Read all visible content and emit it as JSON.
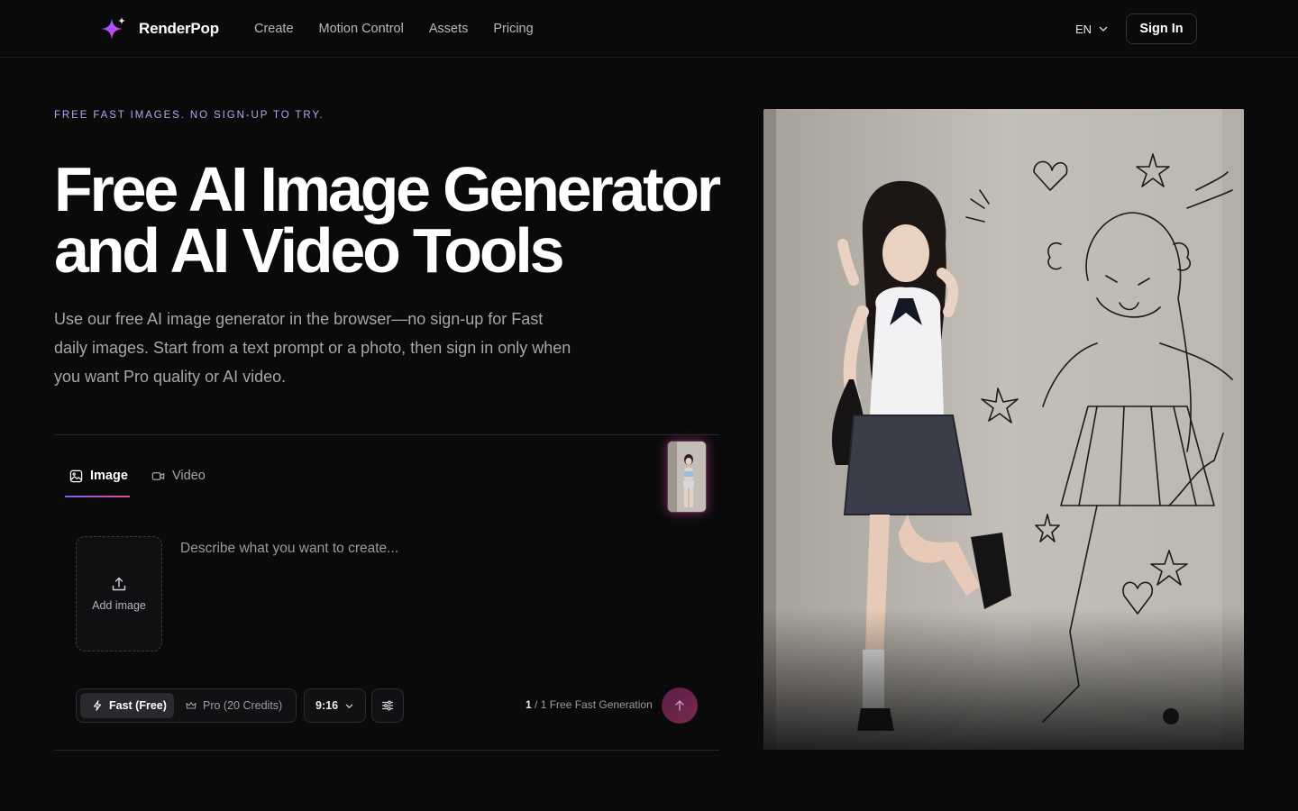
{
  "header": {
    "brand": "RenderPop",
    "nav": [
      "Create",
      "Motion Control",
      "Assets",
      "Pricing"
    ],
    "language": "EN",
    "sign_in_label": "Sign In"
  },
  "hero": {
    "eyebrow": "FREE FAST IMAGES. NO SIGN-UP TO TRY.",
    "title_line1": "Free AI Image Generator",
    "title_line2": "and AI Video Tools",
    "description": "Use our free AI image generator in the browser—no sign-up for Fast daily images. Start from a text prompt or a photo, then sign in only when you want Pro quality or AI video."
  },
  "composer": {
    "tabs": [
      {
        "label": "Image",
        "icon": "image-icon",
        "active": true
      },
      {
        "label": "Video",
        "icon": "video-icon",
        "active": false
      }
    ],
    "add_image_label": "Add image",
    "prompt_placeholder": "Describe what you want to create...",
    "modes": [
      {
        "label": "Fast (Free)",
        "icon": "bolt-icon",
        "selected": true
      },
      {
        "label": "Pro (20 Credits)",
        "icon": "crown-icon",
        "selected": false
      }
    ],
    "aspect_ratio": "9:16",
    "quota_used": "1",
    "quota_rest": "/ 1 Free Fast Generation"
  },
  "colors": {
    "background": "#0a0a0b",
    "eyebrow": "#b9a6f6",
    "accent_gradient_start": "#7c5cf6",
    "accent_gradient_end": "#e0508c",
    "submit_button": "#6a2449"
  }
}
